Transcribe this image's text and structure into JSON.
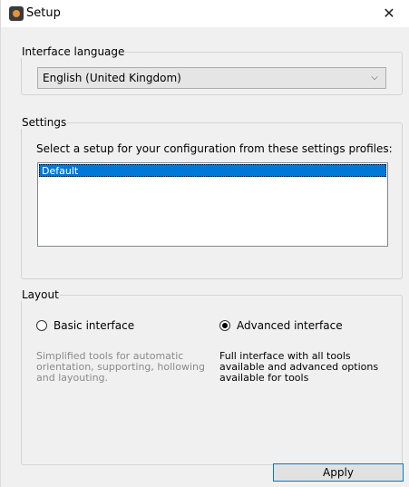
{
  "window": {
    "title": "Setup",
    "close_glyph": "✕"
  },
  "language": {
    "legend": "Interface language",
    "selected": "English (United Kingdom)"
  },
  "settings": {
    "legend": "Settings",
    "prompt": "Select a setup for your configuration from these settings profiles:",
    "profiles": [
      "Default"
    ]
  },
  "layout": {
    "legend": "Layout",
    "basic": {
      "label": "Basic interface",
      "checked": false,
      "description": "Simplified tools for automatic\norientation, supporting, hollowing\nand layouting."
    },
    "advanced": {
      "label": "Advanced interface",
      "checked": true,
      "description": "Full interface with all tools\navailable and advanced options\navailable for tools"
    }
  },
  "footer": {
    "apply_label": "Apply"
  },
  "colors": {
    "selection": "#0078d7",
    "muted_text": "#8a8a8a"
  }
}
